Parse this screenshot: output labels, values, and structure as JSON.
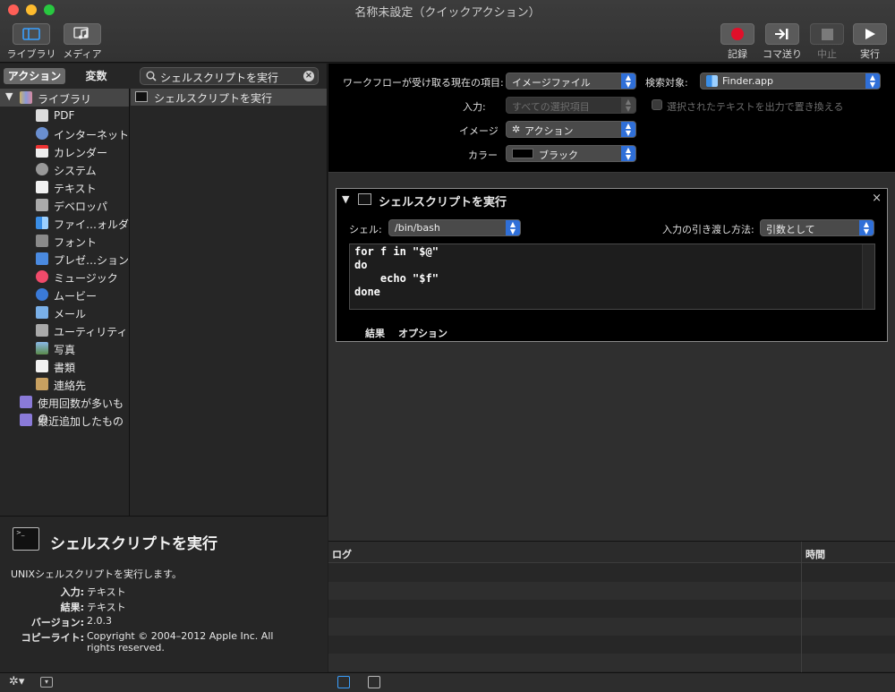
{
  "window": {
    "title": "名称未設定（クイックアクション）"
  },
  "toolbar": {
    "library_label": "ライブラリ",
    "media_label": "メディア",
    "record_label": "記録",
    "step_label": "コマ送り",
    "stop_label": "中止",
    "run_label": "実行"
  },
  "library": {
    "tab_actions": "アクション",
    "tab_variables": "変数",
    "search_query": "シェルスクリプトを実行",
    "root_label": "ライブラリ",
    "categories": [
      "PDF",
      "インターネット",
      "カレンダー",
      "システム",
      "テキスト",
      "デベロッパ",
      "ファイ…ォルダ",
      "フォント",
      "プレゼ…ション",
      "ミュージック",
      "ムービー",
      "メール",
      "ユーティリティ",
      "写真",
      "書類",
      "連絡先"
    ],
    "smart_groups": [
      "使用回数が多いもの",
      "最近追加したもの"
    ],
    "result": "シェルスクリプトを実行"
  },
  "description": {
    "title": "シェルスクリプトを実行",
    "summary": "UNIXシェルスクリプトを実行します。",
    "input_key": "入力:",
    "input_val": "テキスト",
    "result_key": "結果:",
    "result_val": "テキスト",
    "version_key": "バージョン:",
    "version_val": "2.0.3",
    "copyright_key": "コピーライト:",
    "copyright_val": "Copyright © 2004–2012 Apple Inc.  All rights reserved."
  },
  "workflow": {
    "receives_label": "ワークフローが受け取る現在の項目:",
    "receives_value": "イメージファイル",
    "in_label": "検索対象:",
    "in_value": "Finder.app",
    "input_label": "入力:",
    "input_value": "すべての選択項目",
    "replace_label": "選択されたテキストを出力で置き換える",
    "image_label": "イメージ",
    "image_value": "アクション",
    "color_label": "カラー",
    "color_value": "ブラック"
  },
  "action": {
    "title": "シェルスクリプトを実行",
    "shell_label": "シェル:",
    "shell_value": "/bin/bash",
    "pass_label": "入力の引き渡し方法:",
    "pass_value": "引数として",
    "script": "for f in \"$@\"\ndo\n    echo \"$f\"\ndone",
    "tab_results": "結果",
    "tab_options": "オプション"
  },
  "log": {
    "col_log": "ログ",
    "col_time": "時間"
  },
  "colors": {
    "accent": "#2f6fd8",
    "record": "#e0102a"
  }
}
